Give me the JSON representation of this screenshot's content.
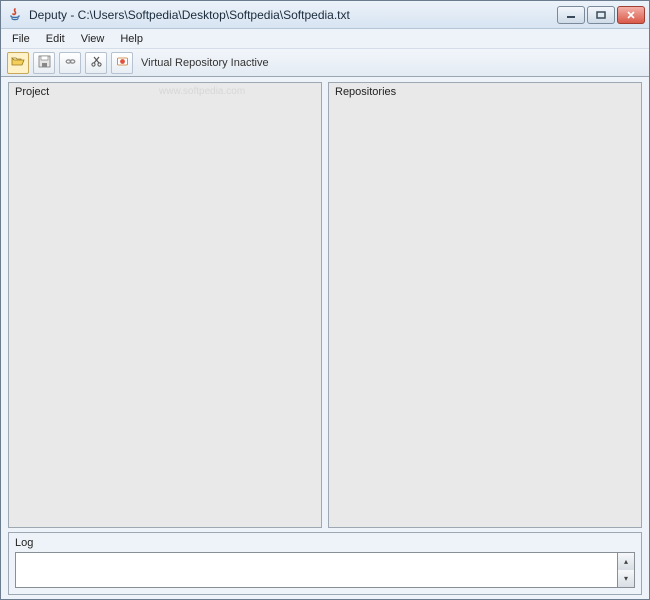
{
  "window": {
    "title": "Deputy - C:\\Users\\Softpedia\\Desktop\\Softpedia\\Softpedia.txt"
  },
  "menu": {
    "file": "File",
    "edit": "Edit",
    "view": "View",
    "help": "Help"
  },
  "toolbar": {
    "status": "Virtual Repository Inactive"
  },
  "panels": {
    "project_label": "Project",
    "repositories_label": "Repositories",
    "watermark": "www.softpedia.com"
  },
  "log": {
    "label": "Log",
    "value": ""
  }
}
